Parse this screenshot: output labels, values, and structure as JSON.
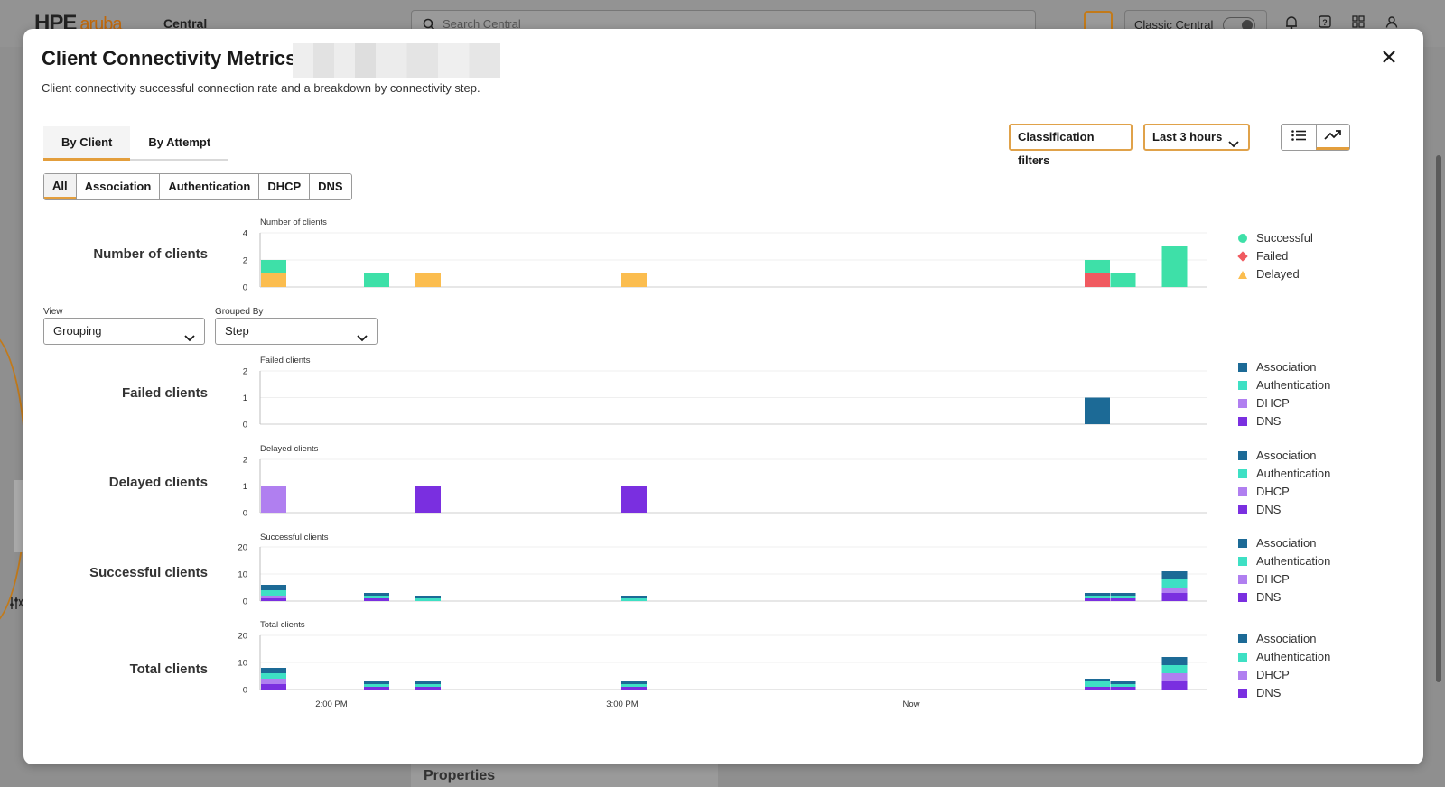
{
  "background_app": {
    "logo": "HPE",
    "logo_brand": "aruba",
    "product": "Central",
    "search_placeholder": "Search Central",
    "classic_label": "Classic Central",
    "properties_label": "Properties"
  },
  "modal": {
    "title": "Client Connectivity Metrics",
    "subtitle": "Client connectivity successful connection rate and a breakdown by connectivity step.",
    "close_icon": "close-icon",
    "tabs": [
      {
        "label": "By Client",
        "active": true
      },
      {
        "label": "By Attempt",
        "active": false
      }
    ],
    "steps": [
      "All",
      "Association",
      "Authentication",
      "DHCP",
      "DNS"
    ],
    "classification_button": "Classification filters",
    "time_range": "Last 3 hours",
    "view_toggle": [
      {
        "icon": "list-icon",
        "active": false
      },
      {
        "icon": "trend-chart-icon",
        "active": true
      }
    ],
    "view": {
      "label": "View",
      "value": "Grouping"
    },
    "grouped_by": {
      "label": "Grouped By",
      "value": "Step"
    },
    "row_labels": {
      "number": "Number of clients",
      "failed": "Failed clients",
      "delayed": "Delayed clients",
      "successful": "Successful clients",
      "total": "Total clients"
    }
  },
  "colors": {
    "successful": "#3ee0a8",
    "failed": "#f05a60",
    "delayed": "#fbbd4f",
    "association": "#1c6a96",
    "authentication": "#3ee0c4",
    "dhcp": "#b07ff0",
    "dns": "#7a2fe0",
    "accent": "#e39e3c"
  },
  "chart_data": [
    {
      "type": "bar",
      "title": "Number of clients",
      "ylim": [
        0,
        4
      ],
      "yticks": [
        0,
        2,
        4
      ],
      "x_ticks": [
        "2:00 PM",
        "3:00 PM",
        "Now"
      ],
      "legend": [
        "Successful",
        "Failed",
        "Delayed"
      ],
      "bins": [
        {
          "slot": 0,
          "Successful": 1,
          "Failed": 0,
          "Delayed": 1
        },
        {
          "slot": 4,
          "Successful": 1,
          "Failed": 0,
          "Delayed": 0
        },
        {
          "slot": 6,
          "Successful": 0,
          "Failed": 0,
          "Delayed": 1
        },
        {
          "slot": 14,
          "Successful": 0,
          "Failed": 0,
          "Delayed": 1
        },
        {
          "slot": 32,
          "Successful": 1,
          "Failed": 1,
          "Delayed": 0
        },
        {
          "slot": 33,
          "Successful": 1,
          "Failed": 0,
          "Delayed": 0
        },
        {
          "slot": 35,
          "Successful": 3,
          "Failed": 0,
          "Delayed": 0
        }
      ]
    },
    {
      "type": "bar",
      "title": "Failed clients",
      "ylim": [
        0,
        2
      ],
      "yticks": [
        0,
        1,
        2
      ],
      "legend": [
        "Association",
        "Authentication",
        "DHCP",
        "DNS"
      ],
      "bins": [
        {
          "slot": 32,
          "Association": 1,
          "Authentication": 0,
          "DHCP": 0,
          "DNS": 0
        }
      ]
    },
    {
      "type": "bar",
      "title": "Delayed clients",
      "ylim": [
        0,
        2
      ],
      "yticks": [
        0,
        1,
        2
      ],
      "legend": [
        "Association",
        "Authentication",
        "DHCP",
        "DNS"
      ],
      "bins": [
        {
          "slot": 0,
          "Association": 0,
          "Authentication": 0,
          "DHCP": 1,
          "DNS": 0
        },
        {
          "slot": 6,
          "Association": 0,
          "Authentication": 0,
          "DHCP": 0,
          "DNS": 1
        },
        {
          "slot": 14,
          "Association": 0,
          "Authentication": 0,
          "DHCP": 0,
          "DNS": 1
        }
      ]
    },
    {
      "type": "bar",
      "title": "Successful clients",
      "ylim": [
        0,
        20
      ],
      "yticks": [
        0,
        10,
        20
      ],
      "legend": [
        "Association",
        "Authentication",
        "DHCP",
        "DNS"
      ],
      "bins": [
        {
          "slot": 0,
          "Association": 2,
          "Authentication": 2,
          "DHCP": 1,
          "DNS": 1
        },
        {
          "slot": 4,
          "Association": 1,
          "Authentication": 1,
          "DHCP": 0,
          "DNS": 1
        },
        {
          "slot": 6,
          "Association": 1,
          "Authentication": 1,
          "DHCP": 0,
          "DNS": 0
        },
        {
          "slot": 14,
          "Association": 1,
          "Authentication": 1,
          "DHCP": 0,
          "DNS": 0
        },
        {
          "slot": 32,
          "Association": 1,
          "Authentication": 1,
          "DHCP": 0,
          "DNS": 1
        },
        {
          "slot": 33,
          "Association": 1,
          "Authentication": 1,
          "DHCP": 0,
          "DNS": 1
        },
        {
          "slot": 35,
          "Association": 3,
          "Authentication": 3,
          "DHCP": 2,
          "DNS": 3
        }
      ]
    },
    {
      "type": "bar",
      "title": "Total clients",
      "ylim": [
        0,
        20
      ],
      "yticks": [
        0,
        10,
        20
      ],
      "legend": [
        "Association",
        "Authentication",
        "DHCP",
        "DNS"
      ],
      "bins": [
        {
          "slot": 0,
          "Association": 2,
          "Authentication": 2,
          "DHCP": 2,
          "DNS": 2
        },
        {
          "slot": 4,
          "Association": 1,
          "Authentication": 1,
          "DHCP": 0,
          "DNS": 1
        },
        {
          "slot": 6,
          "Association": 1,
          "Authentication": 1,
          "DHCP": 0,
          "DNS": 1
        },
        {
          "slot": 14,
          "Association": 1,
          "Authentication": 1,
          "DHCP": 0,
          "DNS": 1
        },
        {
          "slot": 32,
          "Association": 1,
          "Authentication": 2,
          "DHCP": 0,
          "DNS": 1
        },
        {
          "slot": 33,
          "Association": 1,
          "Authentication": 1,
          "DHCP": 0,
          "DNS": 1
        },
        {
          "slot": 35,
          "Association": 3,
          "Authentication": 3,
          "DHCP": 3,
          "DNS": 3
        }
      ]
    }
  ]
}
